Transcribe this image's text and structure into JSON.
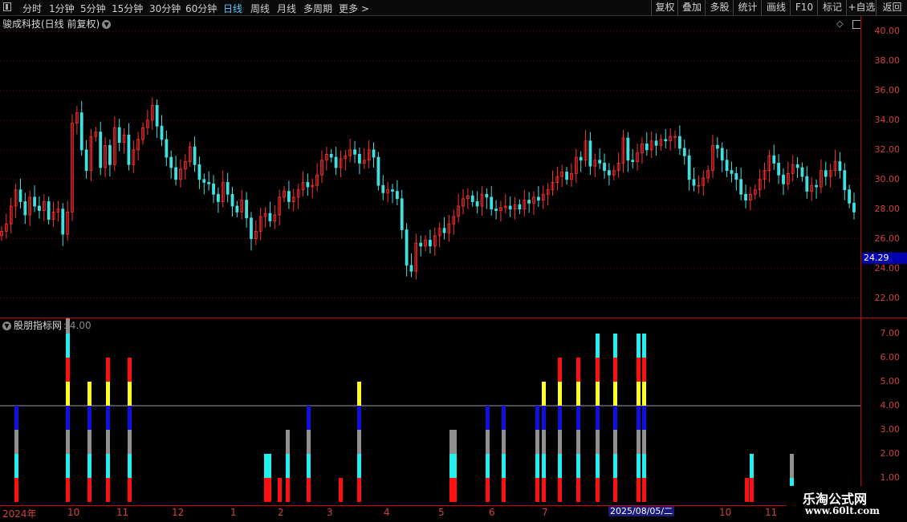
{
  "toolbar": {
    "left_items": [
      "分时",
      "1分钟",
      "5分钟",
      "15分钟",
      "30分钟",
      "60分钟",
      "日线",
      "周线",
      "月线",
      "多周期",
      "更多 >"
    ],
    "active": "日线",
    "right_items": [
      "复权",
      "叠加",
      "多股",
      "统计",
      "画线",
      "F10",
      "标记",
      "+自选",
      "返回"
    ]
  },
  "main_chart": {
    "title": "骏成科技(日线 前复权)",
    "y_ticks": [
      "40.00",
      "38.00",
      "36.00",
      "34.00",
      "32.00",
      "30.00",
      "28.00",
      "26.00",
      "24.00",
      "22.00"
    ],
    "current_price": "24.29"
  },
  "indicator": {
    "title": "股朋指标网",
    "value": ": 4.00",
    "y_ticks": [
      "7.00",
      "6.00",
      "5.00",
      "4.00",
      "3.00",
      "2.00",
      "1.00"
    ]
  },
  "x_axis": {
    "labels": [
      "2024年",
      "10",
      "11",
      "12",
      "1",
      "2",
      "3",
      "4",
      "5",
      "6",
      "7",
      "",
      "10",
      "11"
    ],
    "cursor_date": "2025/08/05/二"
  },
  "watermark": {
    "name": "乐淘公式网",
    "url": "www.60lt.com"
  },
  "colors": {
    "up": "#ff3030",
    "down": "#40e0e0",
    "grid": "#8b0000",
    "axis": "#cc0000"
  },
  "chart_data": {
    "type": "candlestick",
    "ylim": [
      21.0,
      40.6
    ],
    "closes": [
      26.5,
      27.0,
      28.2,
      29.3,
      28.5,
      27.6,
      28.8,
      28.2,
      27.9,
      28.5,
      27.3,
      27.8,
      28.0,
      26.3,
      27.8,
      33.8,
      34.5,
      32.0,
      30.6,
      32.9,
      33.2,
      30.8,
      32.3,
      31.0,
      33.5,
      32.5,
      33.0,
      31.0,
      32.0,
      32.7,
      33.5,
      34.0,
      35.0,
      33.6,
      32.7,
      31.5,
      30.8,
      30.0,
      30.7,
      31.2,
      32.2,
      31.0,
      30.0,
      29.8,
      29.7,
      29.0,
      28.5,
      29.8,
      29.0,
      28.2,
      27.8,
      28.6,
      27.4,
      26.0,
      26.5,
      27.5,
      27.7,
      27.2,
      27.6,
      28.8,
      29.2,
      28.5,
      28.8,
      29.3,
      29.8,
      29.5,
      29.6,
      30.3,
      31.3,
      31.7,
      31.5,
      30.8,
      31.4,
      31.6,
      32.0,
      31.7,
      31.1,
      31.3,
      32.0,
      31.5,
      29.6,
      29.1,
      29.3,
      29.2,
      28.7,
      26.6,
      24.2,
      23.8,
      25.7,
      25.5,
      25.9,
      25.5,
      26.2,
      26.7,
      26.4,
      27.0,
      27.5,
      28.2,
      28.7,
      28.9,
      28.5,
      28.2,
      29.0,
      28.8,
      28.0,
      27.9,
      28.1,
      28.2,
      28.0,
      28.3,
      28.0,
      28.6,
      28.4,
      28.8,
      28.6,
      29.0,
      29.3,
      29.8,
      30.2,
      30.5,
      30.0,
      30.4,
      31.5,
      31.3,
      32.6,
      30.9,
      31.3,
      31.1,
      30.6,
      30.3,
      30.6,
      31.1,
      32.8,
      31.3,
      31.2,
      31.8,
      32.4,
      32.0,
      32.6,
      32.3,
      32.7,
      32.6,
      32.9,
      32.9,
      32.1,
      31.6,
      30.0,
      29.6,
      29.6,
      30.1,
      30.6,
      32.3,
      32.1,
      31.3,
      30.6,
      30.4,
      30.0,
      29.0,
      28.6,
      29.0,
      29.3,
      30.0,
      30.6,
      31.6,
      31.1,
      30.3,
      29.7,
      30.4,
      31.0,
      30.8,
      30.2,
      29.2,
      29.6,
      29.5,
      30.6,
      30.2,
      30.6,
      31.2,
      30.6,
      29.3,
      28.4,
      27.8
    ],
    "indicator": {
      "reference_line": 4.0,
      "bars": [
        {
          "x": 20,
          "stack": [
            "red",
            "cyan",
            "gray",
            "blue"
          ]
        },
        {
          "x": 84,
          "stack": [
            "red",
            "cyan",
            "gray",
            "blue",
            "yellow",
            "red",
            "cyan",
            "gray",
            "blue"
          ]
        },
        {
          "x": 111,
          "stack": [
            "red",
            "cyan",
            "gray",
            "blue",
            "yellow"
          ]
        },
        {
          "x": 134,
          "stack": [
            "red",
            "cyan",
            "gray",
            "blue",
            "yellow",
            "red"
          ]
        },
        {
          "x": 161,
          "stack": [
            "red",
            "cyan",
            "gray",
            "blue",
            "yellow",
            "red"
          ]
        },
        {
          "x": 331,
          "stack": [
            "red",
            "cyan"
          ]
        },
        {
          "x": 335,
          "stack": [
            "red",
            "cyan"
          ]
        },
        {
          "x": 348,
          "stack": [
            "red"
          ]
        },
        {
          "x": 358,
          "stack": [
            "red",
            "cyan",
            "gray"
          ]
        },
        {
          "x": 384,
          "stack": [
            "red",
            "cyan",
            "gray",
            "blue"
          ]
        },
        {
          "x": 424,
          "stack": [
            "red"
          ]
        },
        {
          "x": 447,
          "stack": [
            "red",
            "cyan",
            "gray",
            "blue",
            "yellow"
          ]
        },
        {
          "x": 562,
          "stack": [
            "red",
            "cyan",
            "gray"
          ]
        },
        {
          "x": 566,
          "stack": [
            "red",
            "cyan",
            "gray"
          ]
        },
        {
          "x": 607,
          "stack": [
            "red",
            "cyan",
            "gray",
            "blue"
          ]
        },
        {
          "x": 627,
          "stack": [
            "red",
            "cyan",
            "gray",
            "blue"
          ]
        },
        {
          "x": 669,
          "stack": [
            "red",
            "cyan",
            "gray",
            "blue"
          ]
        },
        {
          "x": 677,
          "stack": [
            "red",
            "cyan",
            "gray",
            "blue",
            "yellow"
          ]
        },
        {
          "x": 697,
          "stack": [
            "red",
            "cyan",
            "gray",
            "blue",
            "yellow",
            "red"
          ]
        },
        {
          "x": 720,
          "stack": [
            "red",
            "cyan",
            "gray",
            "blue",
            "yellow",
            "red"
          ]
        },
        {
          "x": 744,
          "stack": [
            "red",
            "cyan",
            "gray",
            "blue",
            "yellow",
            "red",
            "cyan"
          ]
        },
        {
          "x": 766,
          "stack": [
            "red",
            "cyan",
            "gray",
            "blue",
            "yellow",
            "red",
            "cyan"
          ]
        },
        {
          "x": 795,
          "stack": [
            "red",
            "cyan",
            "gray",
            "blue",
            "yellow",
            "red",
            "cyan"
          ]
        },
        {
          "x": 802,
          "stack": [
            "red",
            "cyan",
            "gray",
            "blue",
            "yellow",
            "red",
            "cyan"
          ]
        },
        {
          "x": 930,
          "stack": [
            "red"
          ]
        },
        {
          "x": 936,
          "stack": [
            "red",
            "cyan"
          ]
        },
        {
          "x": 986,
          "stack": [
            "cyan",
            "gray"
          ]
        }
      ]
    }
  }
}
